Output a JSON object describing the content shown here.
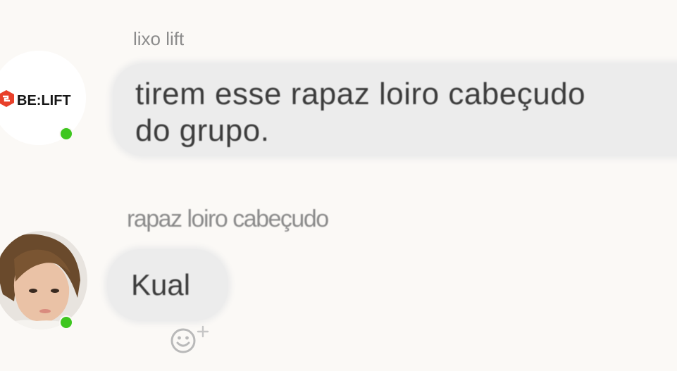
{
  "messages": [
    {
      "sender": "lixo lift",
      "avatar_text": "BE:LIFT",
      "avatar_accent": "#e8402a",
      "online": true,
      "text": "tirem esse rapaz loiro cabeçudo do grupo."
    },
    {
      "sender": "rapaz loiro cabeçudo",
      "avatar_icon": "person-photo",
      "online": true,
      "text": "Kual",
      "reaction_icon": "add-reaction-icon"
    }
  ],
  "colors": {
    "background": "#fbf9f6",
    "bubble": "#ececec",
    "online": "#3ec61f",
    "sender_text": "#8a8a8a",
    "message_text": "#3b3b3b"
  }
}
